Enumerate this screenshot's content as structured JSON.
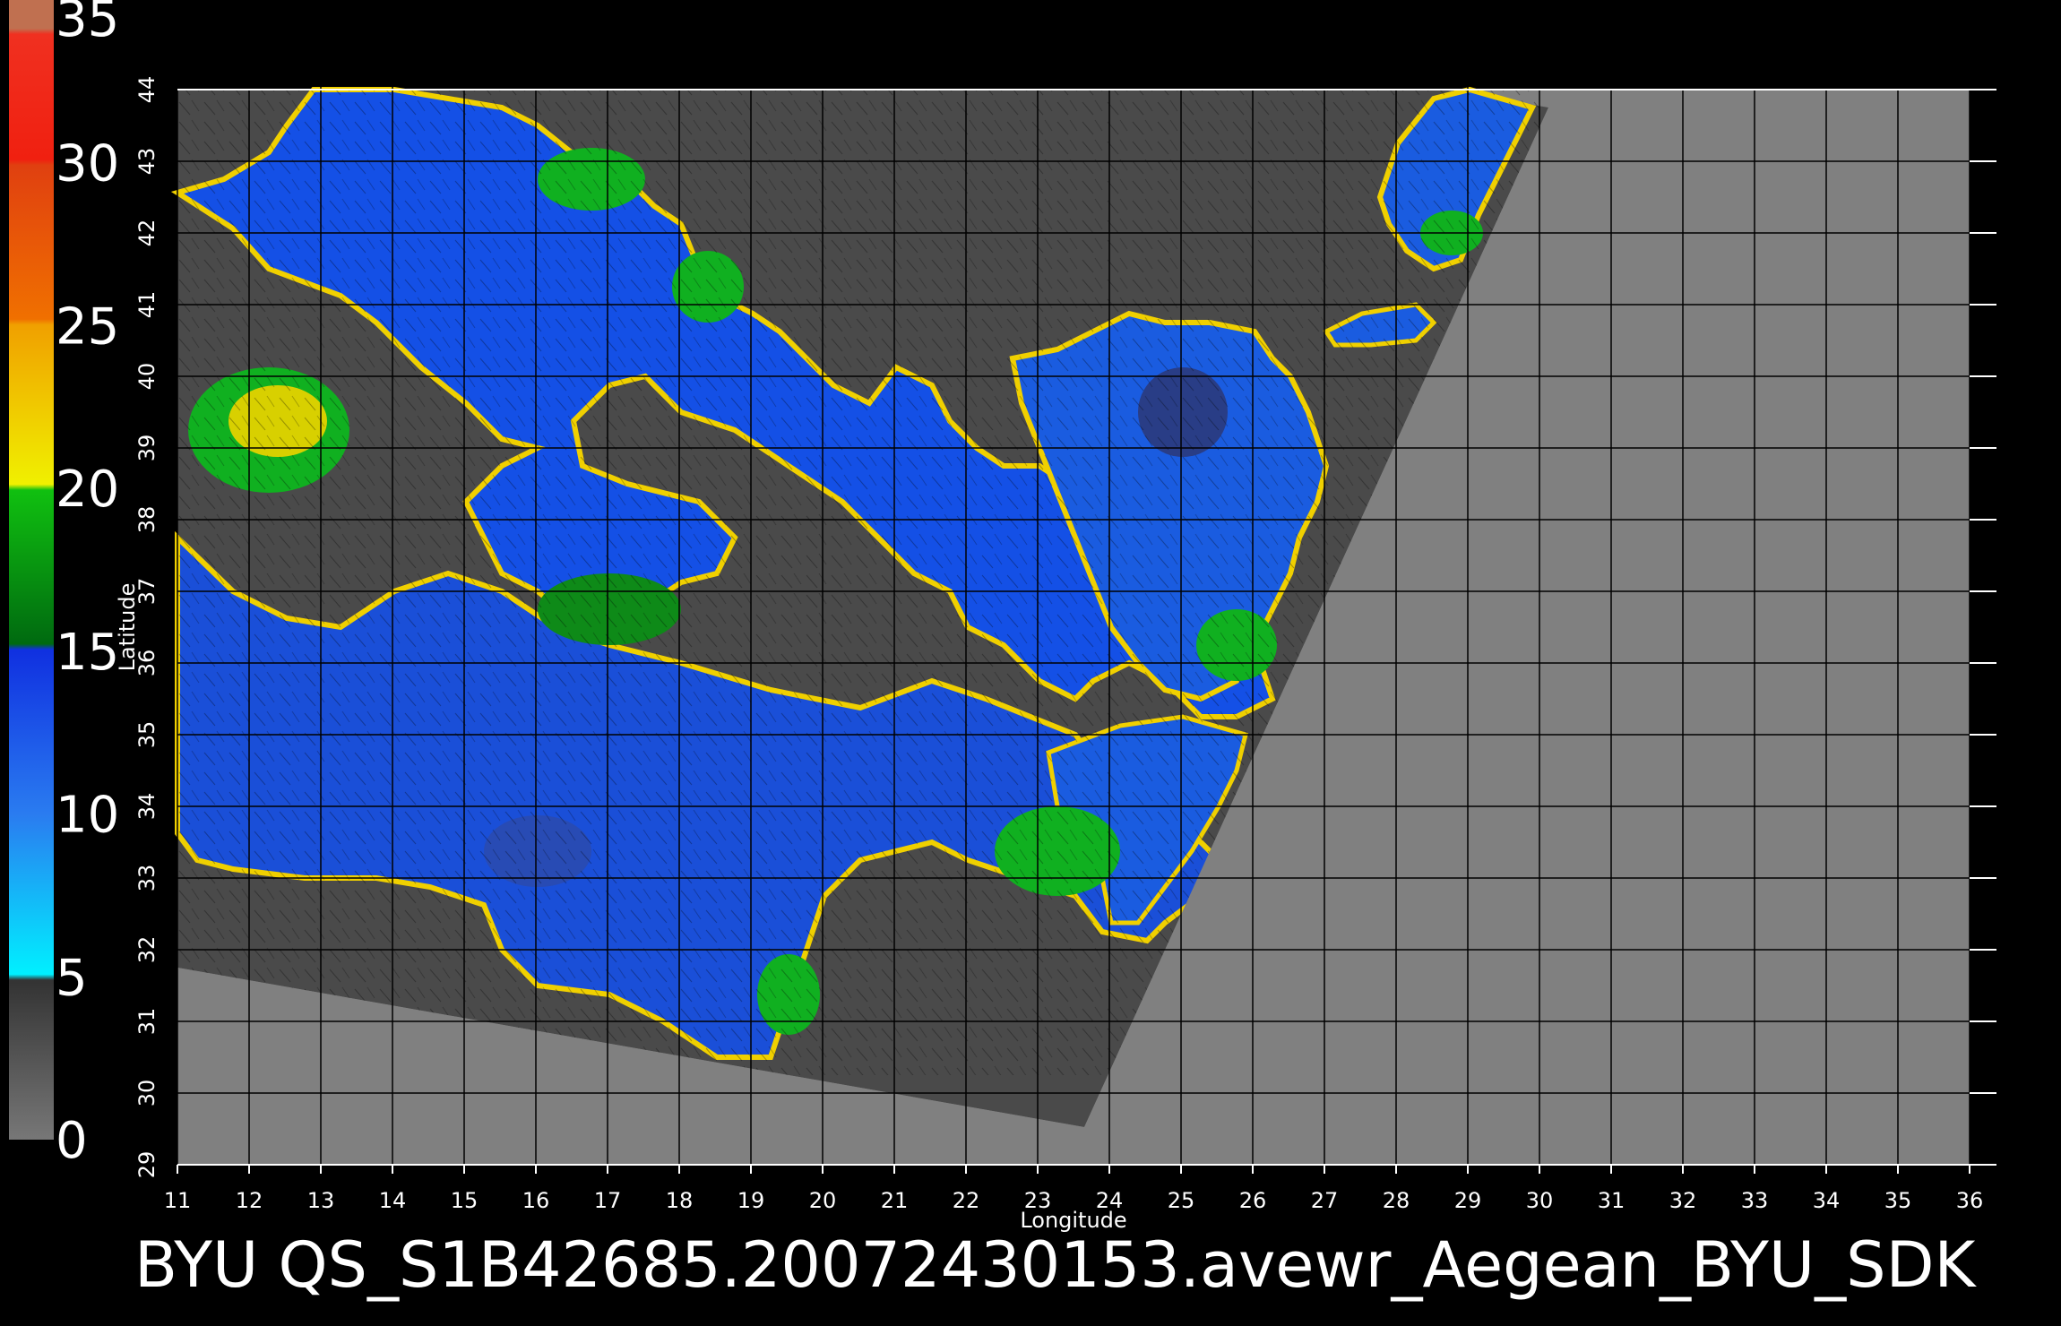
{
  "title_bar": {
    "text": "BYU  QS_S1B42685.20072430153.avewr_Aegean_BYU_SDK"
  },
  "axes": {
    "xlabel": "Longitude",
    "ylabel": "Latitude",
    "x_ticks": [
      "11",
      "12",
      "13",
      "14",
      "15",
      "16",
      "17",
      "18",
      "19",
      "20",
      "21",
      "22",
      "23",
      "24",
      "25",
      "26",
      "27",
      "28",
      "29",
      "30",
      "31",
      "32",
      "33",
      "34",
      "35",
      "36"
    ],
    "y_ticks": [
      "29",
      "30",
      "31",
      "32",
      "33",
      "34",
      "35",
      "36",
      "37",
      "38",
      "39",
      "40",
      "41",
      "42",
      "43",
      "44"
    ],
    "xlim": [
      11,
      36
    ],
    "ylim": [
      29,
      44
    ]
  },
  "colorbar": {
    "labels": [
      "0",
      "5",
      "10",
      "15",
      "20",
      "25",
      "30",
      "35"
    ],
    "range": [
      0,
      35
    ],
    "bands": [
      {
        "from": 0,
        "to": 5,
        "color": "#555555"
      },
      {
        "from": 5,
        "to": 10,
        "color": "#18c8f0"
      },
      {
        "from": 10,
        "to": 15,
        "color": "#1450e6"
      },
      {
        "from": 15,
        "to": 20,
        "color": "#0a9a1a"
      },
      {
        "from": 20,
        "to": 25,
        "color": "#f2d000"
      },
      {
        "from": 25,
        "to": 30,
        "color": "#f07010"
      },
      {
        "from": 30,
        "to": 35,
        "color": "#f02010"
      }
    ]
  },
  "colors": {
    "background": "#000000",
    "land": "#4a4a4a",
    "no_data": "#808080",
    "sea": "#1450e6",
    "grid": "#000000"
  }
}
